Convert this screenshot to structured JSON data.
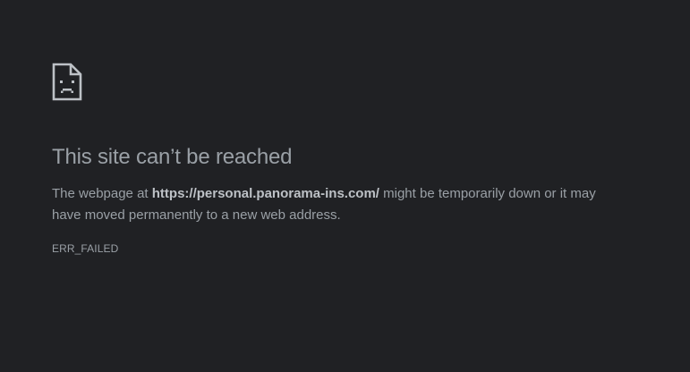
{
  "error": {
    "icon": "sad-page-icon",
    "title": "This site can’t be reached",
    "description_prefix": "The webpage at ",
    "url": "https://personal.panorama-ins.com/",
    "description_suffix": " might be temporarily down or it may have moved permanently to a new web address.",
    "code": "ERR_FAILED"
  },
  "colors": {
    "background": "#202124",
    "text": "#9aa0a6",
    "url_text": "#bdc1c6",
    "icon_stroke": "#bdc1c6"
  }
}
